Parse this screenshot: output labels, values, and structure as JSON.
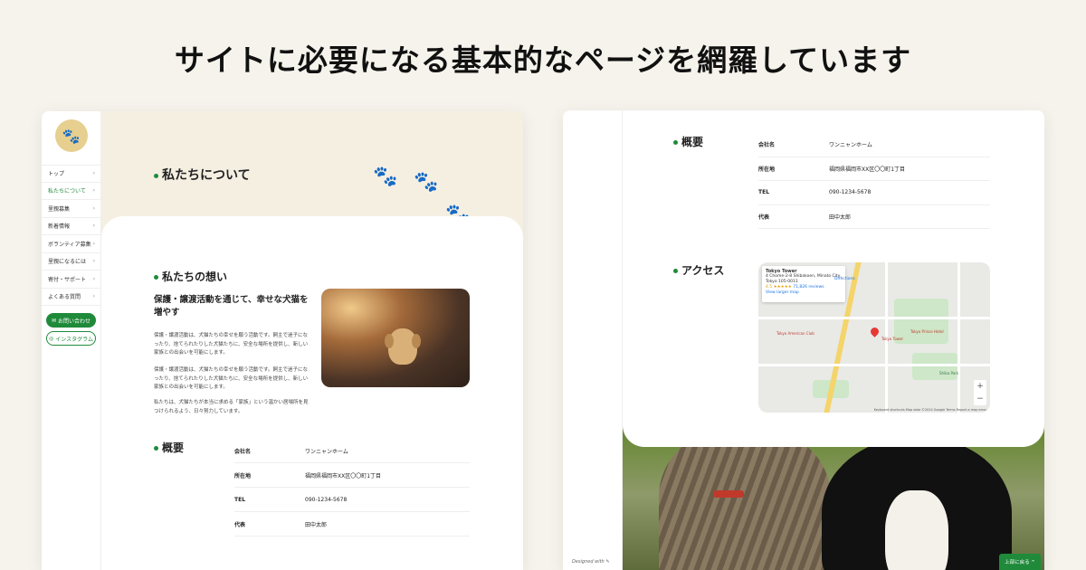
{
  "headline": "サイトに必要になる基本的なページを網羅しています",
  "left": {
    "nav": [
      {
        "label": "トップ",
        "active": false
      },
      {
        "label": "私たちについて",
        "active": true
      },
      {
        "label": "里親募集",
        "active": false
      },
      {
        "label": "新着情報",
        "active": false
      },
      {
        "label": "ボランティア募集",
        "active": false
      },
      {
        "label": "里親になるには",
        "active": false
      },
      {
        "label": "寄付・サポート",
        "active": false
      },
      {
        "label": "よくある質問",
        "active": false
      }
    ],
    "contact_label": "お問い合わせ",
    "insta_label": "インスタグラム",
    "hero_title": "私たちについて",
    "thoughts_title": "私たちの想い",
    "subheading": "保護・譲渡活動を通じて、幸せな犬猫を増やす",
    "para1": "保護・譲渡活動は、犬猫たちの幸せを願う活動です。飼主で迷子になったり、捨てられたりした犬猫たちに、安全な場所を提供し、新しい家族との出会いを可能にします。",
    "para2": "保護・譲渡活動は、犬猫たちの幸せを願う活動です。飼主で迷子になったり、捨てられたりした犬猫たちに、安全な場所を提供し、新しい家族との出会いを可能にします。",
    "para3": "私たちは、犬猫たちが本当に求める「家族」という温かい居場所を見つけられるよう、日々努力しています。",
    "overview_title": "概要",
    "overview": [
      {
        "key": "会社名",
        "value": "ワンニャンホーム"
      },
      {
        "key": "所在地",
        "value": "福岡県福岡市XX区〇〇町1丁目"
      },
      {
        "key": "TEL",
        "value": "090-1234-5678"
      },
      {
        "key": "代表",
        "value": "田中太郎"
      }
    ]
  },
  "right": {
    "overview_title": "概要",
    "overview": [
      {
        "key": "会社名",
        "value": "ワンニャンホーム"
      },
      {
        "key": "所在地",
        "value": "福岡県福岡市XX区〇〇町1丁目"
      },
      {
        "key": "TEL",
        "value": "090-1234-5678"
      },
      {
        "key": "代表",
        "value": "田中太郎"
      }
    ],
    "access_title": "アクセス",
    "map": {
      "place": "Tokyo Tower",
      "address": "4 Chome-2-8 Shibakoen, Minato City, Tokyo 105-0011",
      "rating": "4.5 ★★★★★",
      "reviews": "71,826 reviews",
      "larger": "View larger map",
      "directions": "Directions",
      "footer": "Keyboard shortcuts  Map data ©2024 Google  Terms  Report a map error",
      "labels": [
        "Tokyo Tower",
        "Tokyo Prince Hotel",
        "Tokyo American Club",
        "Shiba Park"
      ]
    },
    "designed": "Designed with",
    "back_to_top": "上部に戻る ^"
  },
  "colors": {
    "accent": "#1f8a3a",
    "hero_bg": "#f5efe2",
    "page_bg": "#f6f3ec",
    "logo": "#e6cf8f"
  }
}
